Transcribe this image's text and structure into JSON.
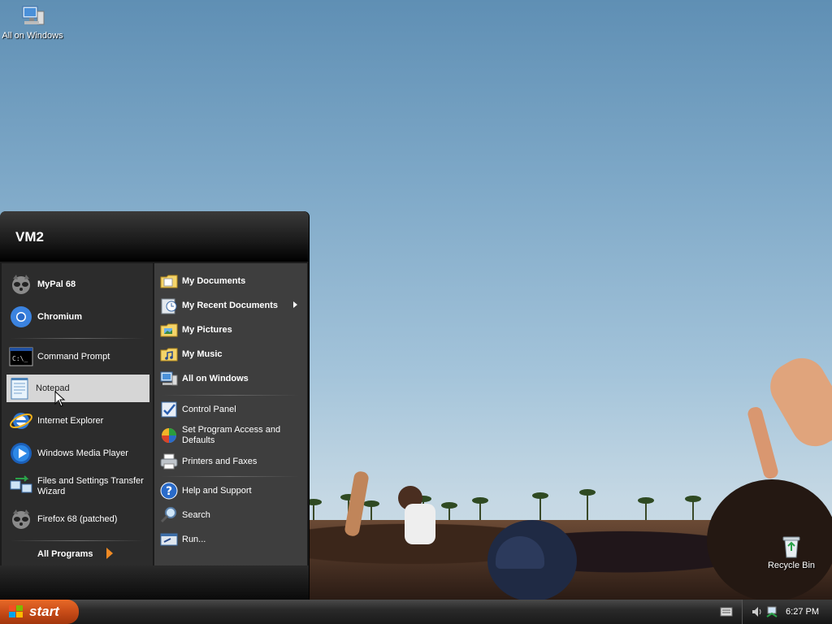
{
  "desktop": {
    "icons": [
      {
        "label": "All on Windows"
      },
      {
        "label": "Recycle Bin"
      }
    ]
  },
  "start_menu": {
    "user": "VM2",
    "left_items": [
      {
        "label": "MyPal 68"
      },
      {
        "label": "Chromium"
      },
      {
        "label": "Command Prompt"
      },
      {
        "label": "Notepad"
      },
      {
        "label": "Internet Explorer"
      },
      {
        "label": "Windows Media Player"
      },
      {
        "label": "Files and Settings Transfer Wizard"
      },
      {
        "label": "Firefox 68 (patched)"
      }
    ],
    "all_programs": "All Programs",
    "right_items": [
      {
        "label": "My Documents"
      },
      {
        "label": "My Recent Documents"
      },
      {
        "label": "My Pictures"
      },
      {
        "label": "My Music"
      },
      {
        "label": "All on Windows"
      },
      {
        "label": "Control Panel"
      },
      {
        "label": "Set Program Access and Defaults"
      },
      {
        "label": "Printers and Faxes"
      },
      {
        "label": "Help and Support"
      },
      {
        "label": "Search"
      },
      {
        "label": "Run..."
      }
    ]
  },
  "taskbar": {
    "start_label": "start",
    "clock": "6:27 PM"
  },
  "icons": {
    "desktop_all_on_windows": "computer-network-icon",
    "recycle_bin": "recycle-bin-icon",
    "mypal": "raccoon-icon",
    "chromium": "chromium-icon",
    "cmd": "terminal-icon",
    "notepad": "notepad-icon",
    "ie": "internet-explorer-icon",
    "wmp": "media-player-icon",
    "transfer": "transfer-wizard-icon",
    "firefox": "raccoon-icon"
  }
}
